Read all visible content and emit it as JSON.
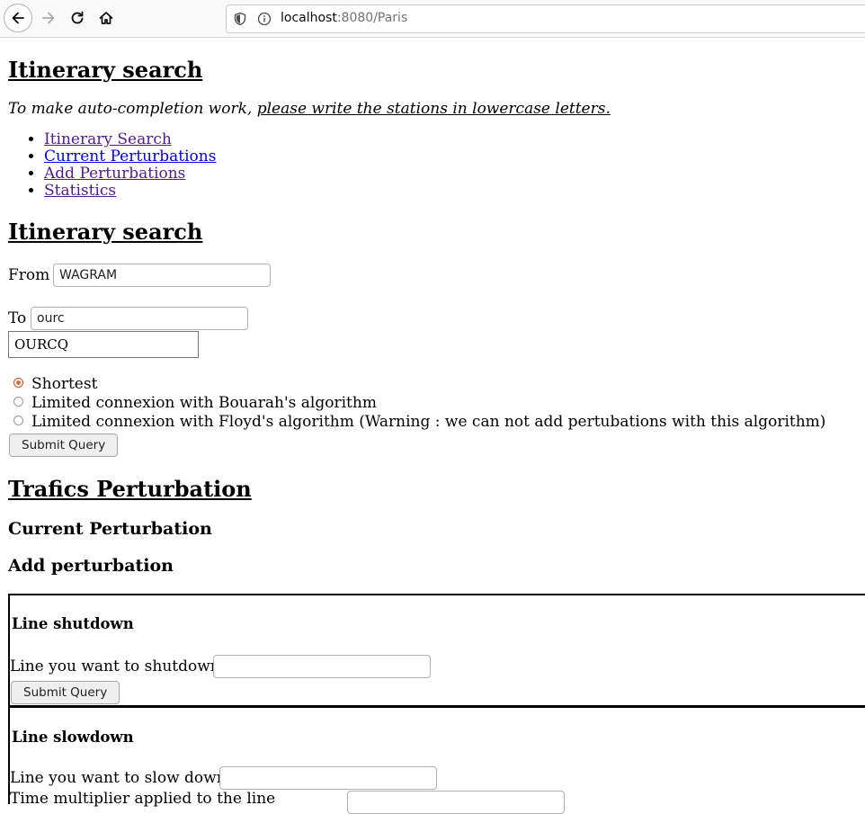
{
  "browser": {
    "url_host": "localhost",
    "url_rest": ":8080/Paris"
  },
  "page": {
    "title": "Itinerary search",
    "note_prefix": "To make auto-completion work, ",
    "note_link": "please write the stations in lowercase letters.",
    "nav": [
      {
        "label": "Itinerary Search",
        "visited": true
      },
      {
        "label": "Current Perturbations",
        "visited": false
      },
      {
        "label": "Add Perturbations",
        "visited": true
      },
      {
        "label": "Statistics",
        "visited": true
      }
    ]
  },
  "search": {
    "heading": "Itinerary search",
    "from_label": "From",
    "from_value": "WAGRAM",
    "to_label": "To",
    "to_value": "ourc",
    "suggestion": "OURCQ",
    "options": [
      {
        "label": "Shortest",
        "checked": true
      },
      {
        "label": "Limited connexion with Bouarah's algorithm",
        "checked": false
      },
      {
        "label": "Limited connexion with Floyd's algorithm (Warning : we can not add pertubations with this algorithm)",
        "checked": false
      }
    ],
    "submit": "Submit Query"
  },
  "perturbation": {
    "heading": "Trafics Perturbation",
    "current_heading": "Current Perturbation",
    "add_heading": "Add perturbation",
    "shutdown": {
      "title": "Line shutdown",
      "label": "Line you want to shutdown",
      "value": "",
      "submit": "Submit Query"
    },
    "slowdown": {
      "title": "Line slowdown",
      "label": "Line you want to slow down",
      "value": "",
      "multiplier_label": "Time multiplier applied to the line",
      "multiplier_value": ""
    }
  }
}
